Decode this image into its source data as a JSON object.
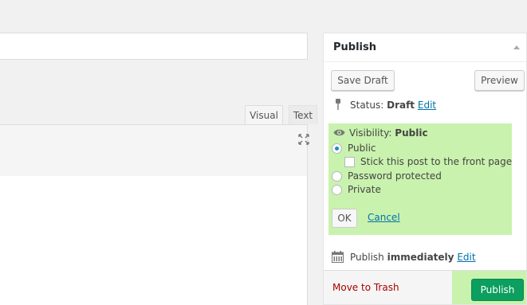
{
  "editor": {
    "tabs": [
      {
        "label": "Visual"
      },
      {
        "label": "Text"
      }
    ]
  },
  "publish": {
    "title": "Publish",
    "save_draft_label": "Save Draft",
    "preview_label": "Preview",
    "status": {
      "label": "Status:",
      "value": "Draft",
      "edit_label": "Edit"
    },
    "visibility": {
      "label": "Visibility:",
      "value": "Public",
      "options": [
        {
          "label": "Public",
          "checked": true
        },
        {
          "label": "Password protected",
          "checked": false
        },
        {
          "label": "Private",
          "checked": false
        }
      ],
      "sticky_label": "Stick this post to the front page",
      "sticky_checked": false,
      "ok_label": "OK",
      "cancel_label": "Cancel",
      "highlight_color": "#c9f2ae"
    },
    "schedule": {
      "label": "Publish",
      "value": "immediately",
      "edit_label": "Edit"
    },
    "trash_label": "Move to Trash",
    "publish_button_label": "Publish",
    "publish_button_color": "#0c9f5f"
  }
}
